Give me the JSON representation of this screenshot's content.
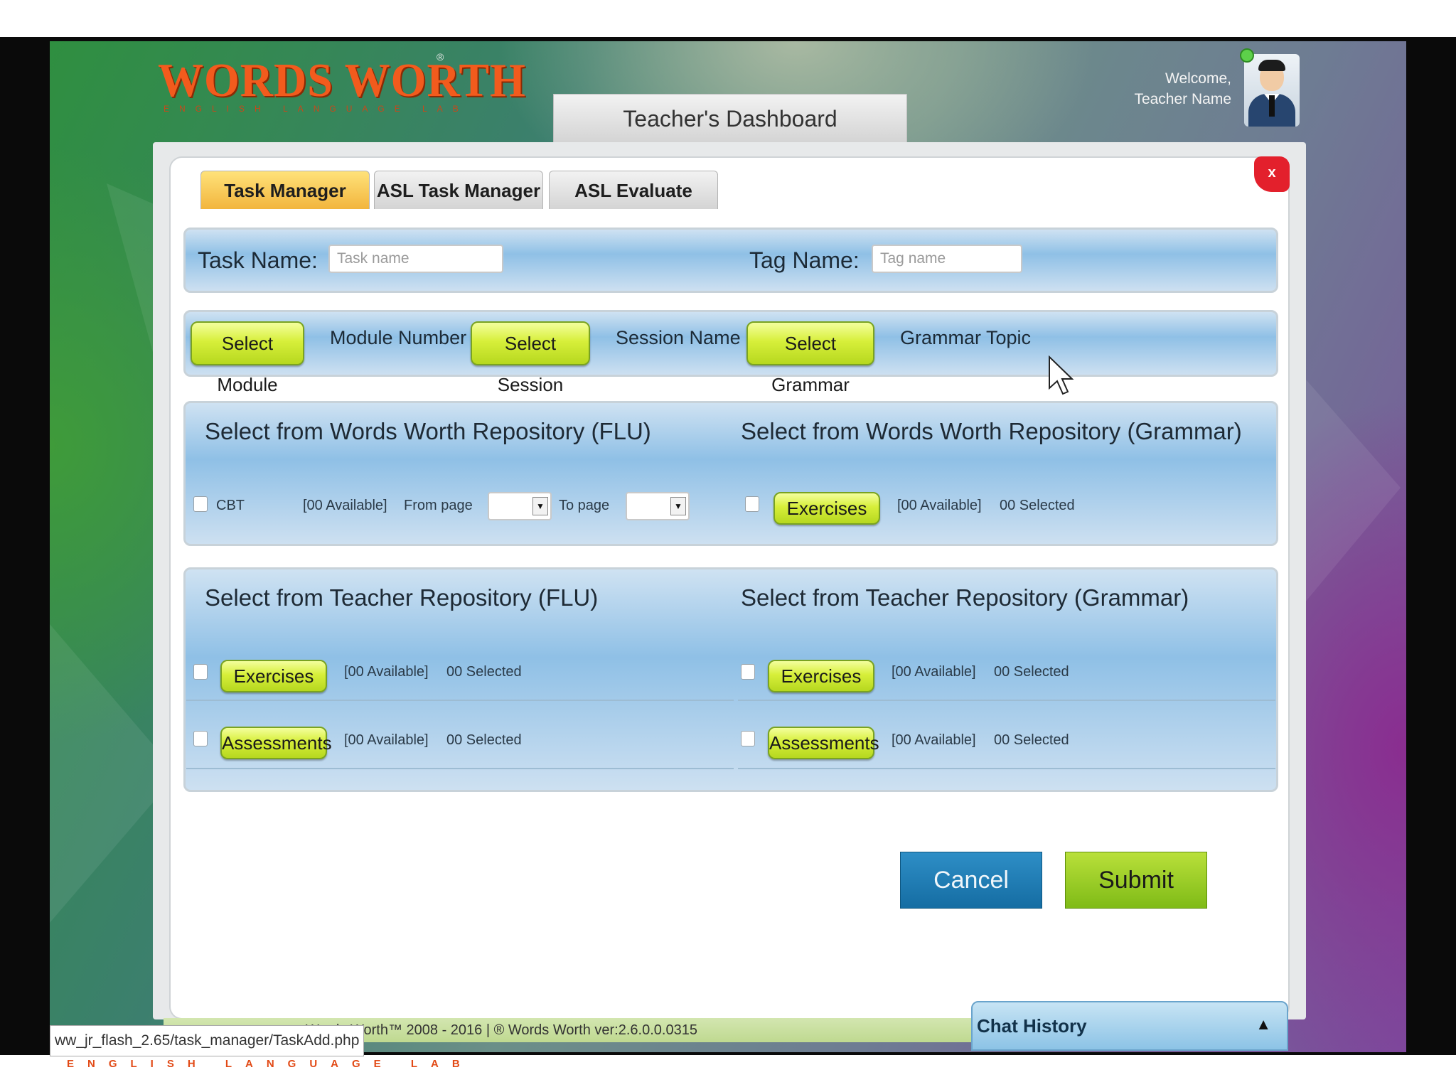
{
  "brand": {
    "logo": "WORDS WORTH",
    "logo_sub": "ENGLISH LANGUAGE LAB",
    "registered": "®"
  },
  "header": {
    "dashboard_title": "Teacher's Dashboard",
    "welcome": "Welcome,",
    "teacher_name": "Teacher Name"
  },
  "tabs": [
    {
      "label": "Task Manager",
      "active": true
    },
    {
      "label": "ASL Task Manager",
      "active": false
    },
    {
      "label": "ASL Evaluate",
      "active": false
    }
  ],
  "close_label": "x",
  "task": {
    "name_label": "Task Name:",
    "name_placeholder": "Task name",
    "tag_label": "Tag Name:",
    "tag_placeholder": "Tag name"
  },
  "selectors": {
    "module_button": "Select Module",
    "module_value": "Module Number",
    "session_button": "Select Session",
    "session_value": "Session Name",
    "grammar_button": "Select Grammar",
    "grammar_value": "Grammar Topic"
  },
  "ww_repo": {
    "flu_title": "Select from Words Worth Repository (FLU)",
    "grammar_title": "Select from Words Worth Repository (Grammar)",
    "cbt_label": "CBT",
    "cbt_available": "[00 Available]",
    "from_page": "From page",
    "to_page": "To page",
    "grammar_button": "Exercises",
    "grammar_available": "[00 Available]",
    "grammar_selected": "00 Selected"
  },
  "teacher_repo": {
    "flu_title": "Select from Teacher Repository (FLU)",
    "grammar_title": "Select from Teacher Repository (Grammar)",
    "flu_rows": [
      {
        "button": "Exercises",
        "available": "[00 Available]",
        "selected": "00 Selected"
      },
      {
        "button": "Assessments",
        "available": "[00 Available]",
        "selected": "00 Selected"
      }
    ],
    "grammar_rows": [
      {
        "button": "Exercises",
        "available": "[00 Available]",
        "selected": "00 Selected"
      },
      {
        "button": "Assessments",
        "available": "[00 Available]",
        "selected": "00 Selected"
      }
    ]
  },
  "actions": {
    "cancel": "Cancel",
    "submit": "Submit"
  },
  "footer": {
    "copyright": "Words Worth™ 2008 - 2016 | ® Words Worth ver:2.6.0.0.0315"
  },
  "chat": {
    "label": "Chat History",
    "toggle_icon": "▲"
  },
  "status_bar": {
    "url": "ww_jr_flash_2.65/task_manager/TaskAdd.php"
  },
  "bottom_tag": "ENGLISH LANGUAGE LAB",
  "colors": {
    "accent_green": "#c8e62c",
    "cancel_blue": "#1a78b0",
    "tab_active": "#f5c14b",
    "logo_orange": "#f25b1d",
    "close_red": "#e3202c"
  }
}
